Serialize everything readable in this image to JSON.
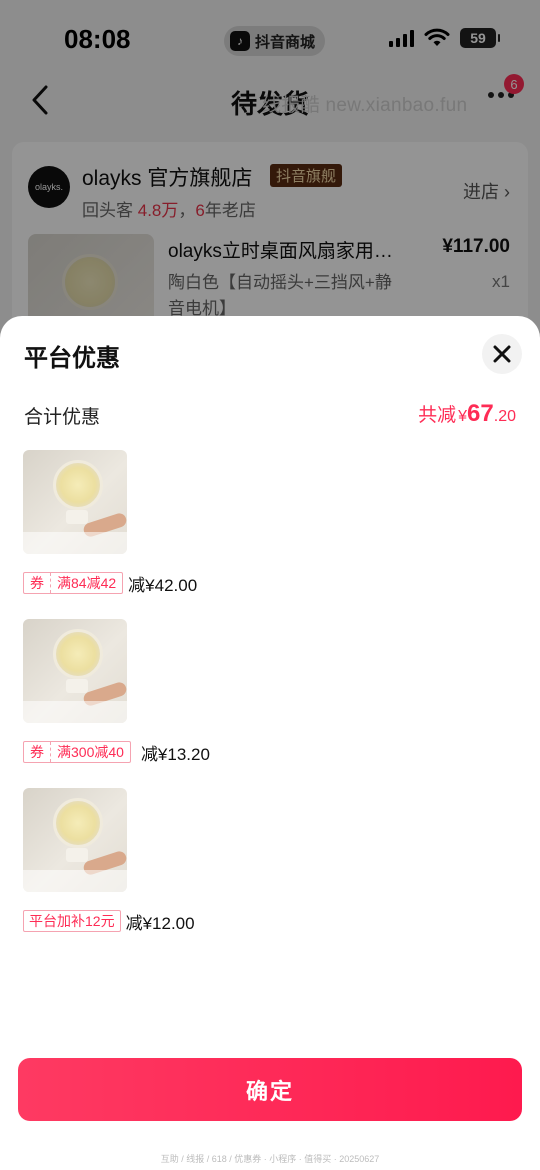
{
  "status_bar": {
    "time": "08:08",
    "app_label": "抖音商城",
    "battery": "59"
  },
  "nav": {
    "title": "待发货",
    "watermark": "线报酷 new.xianbao.fun",
    "more_badge": "6"
  },
  "store": {
    "logo_text": "olayks.",
    "name": "olayks 官方旗舰店",
    "tag": "抖音旗舰",
    "sub_prefix": "回头客 ",
    "returning": "4.8万",
    "sub_mid": "，",
    "years": "6",
    "sub_suffix": "年老店",
    "enter_label": "进店"
  },
  "product": {
    "title": "olayks立时桌面风扇家用…",
    "price": "¥117.00",
    "spec": "陶白色【自动摇头+三挡风+静音电机】",
    "qty": "x1"
  },
  "sheet": {
    "title": "平台优惠",
    "total_label": "合计优惠",
    "total_prefix": "共减",
    "total_yen": "¥",
    "total_int": "67",
    "total_dec": ".20",
    "discounts": [
      {
        "kind": "券",
        "desc": "满84减42",
        "amount": "减¥42.00"
      },
      {
        "kind": "券",
        "desc": "满300减40",
        "amount": "减¥13.20"
      },
      {
        "kind": "",
        "desc": "平台加补12元",
        "amount": "减¥12.00"
      }
    ],
    "confirm_label": "确定"
  },
  "footer_note": "互助 / 线报 / 618 / 优惠券 · 小程序 · 值得买 · 20250627"
}
